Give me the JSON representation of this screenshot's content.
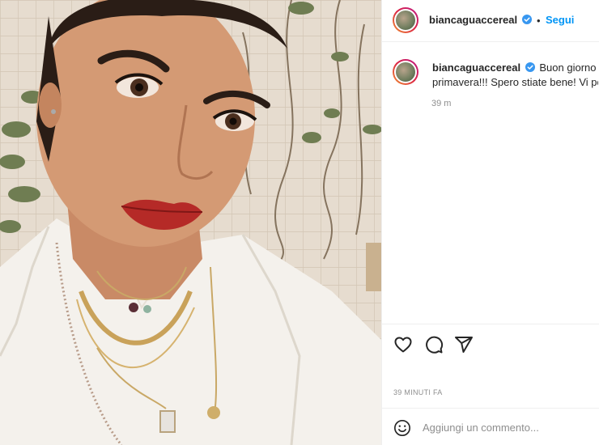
{
  "post": {
    "username": "biancaguaccereal",
    "follow_label": "Segui",
    "dot": "•",
    "caption_line1": "Buon giorno r",
    "caption_line2": "primavera!!! Spero stiate bene! Vi por",
    "time_short": "39 m",
    "posted_ago": "39 MINUTI FA",
    "comment_placeholder": "Aggiungi un commento..."
  },
  "icons": {
    "verified": "verified-badge-icon",
    "like": "heart-icon",
    "comment": "comment-bubble-icon",
    "share": "paper-plane-icon",
    "emoji": "smiley-icon"
  },
  "colors": {
    "accent": "#0095f6",
    "verified": "#3897f0",
    "text": "#262626",
    "muted": "#8e8e8e"
  }
}
